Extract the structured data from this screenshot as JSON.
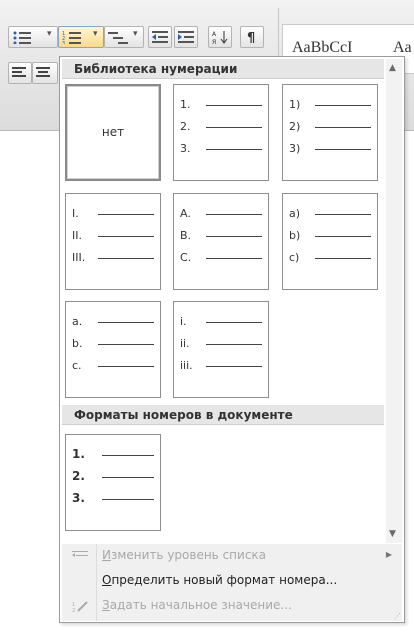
{
  "ribbon": {
    "style_sample": "AaBbCcI",
    "style_sample2": "Aa"
  },
  "dropdown": {
    "library_header": "Библиотека нумерации",
    "none_label": "нет",
    "tiles": [
      {
        "markers": [
          "1.",
          "2.",
          "3."
        ]
      },
      {
        "markers": [
          "1)",
          "2)",
          "3)"
        ]
      },
      {
        "markers": [
          "I.",
          "II.",
          "III."
        ]
      },
      {
        "markers": [
          "A.",
          "B.",
          "C."
        ]
      },
      {
        "markers": [
          "a)",
          "b)",
          "c)"
        ]
      },
      {
        "markers": [
          "a.",
          "b.",
          "c."
        ]
      },
      {
        "markers": [
          "i.",
          "ii.",
          "iii."
        ]
      }
    ],
    "doc_header": "Форматы номеров в документе",
    "doc_tile": {
      "markers": [
        "1.",
        "2.",
        "3."
      ]
    }
  },
  "menu": {
    "items": [
      {
        "label": "Изменить уровень списка",
        "enabled": false
      },
      {
        "label": "Определить новый формат номера...",
        "enabled": true
      },
      {
        "label": "Задать начальное значение...",
        "enabled": false
      }
    ]
  }
}
